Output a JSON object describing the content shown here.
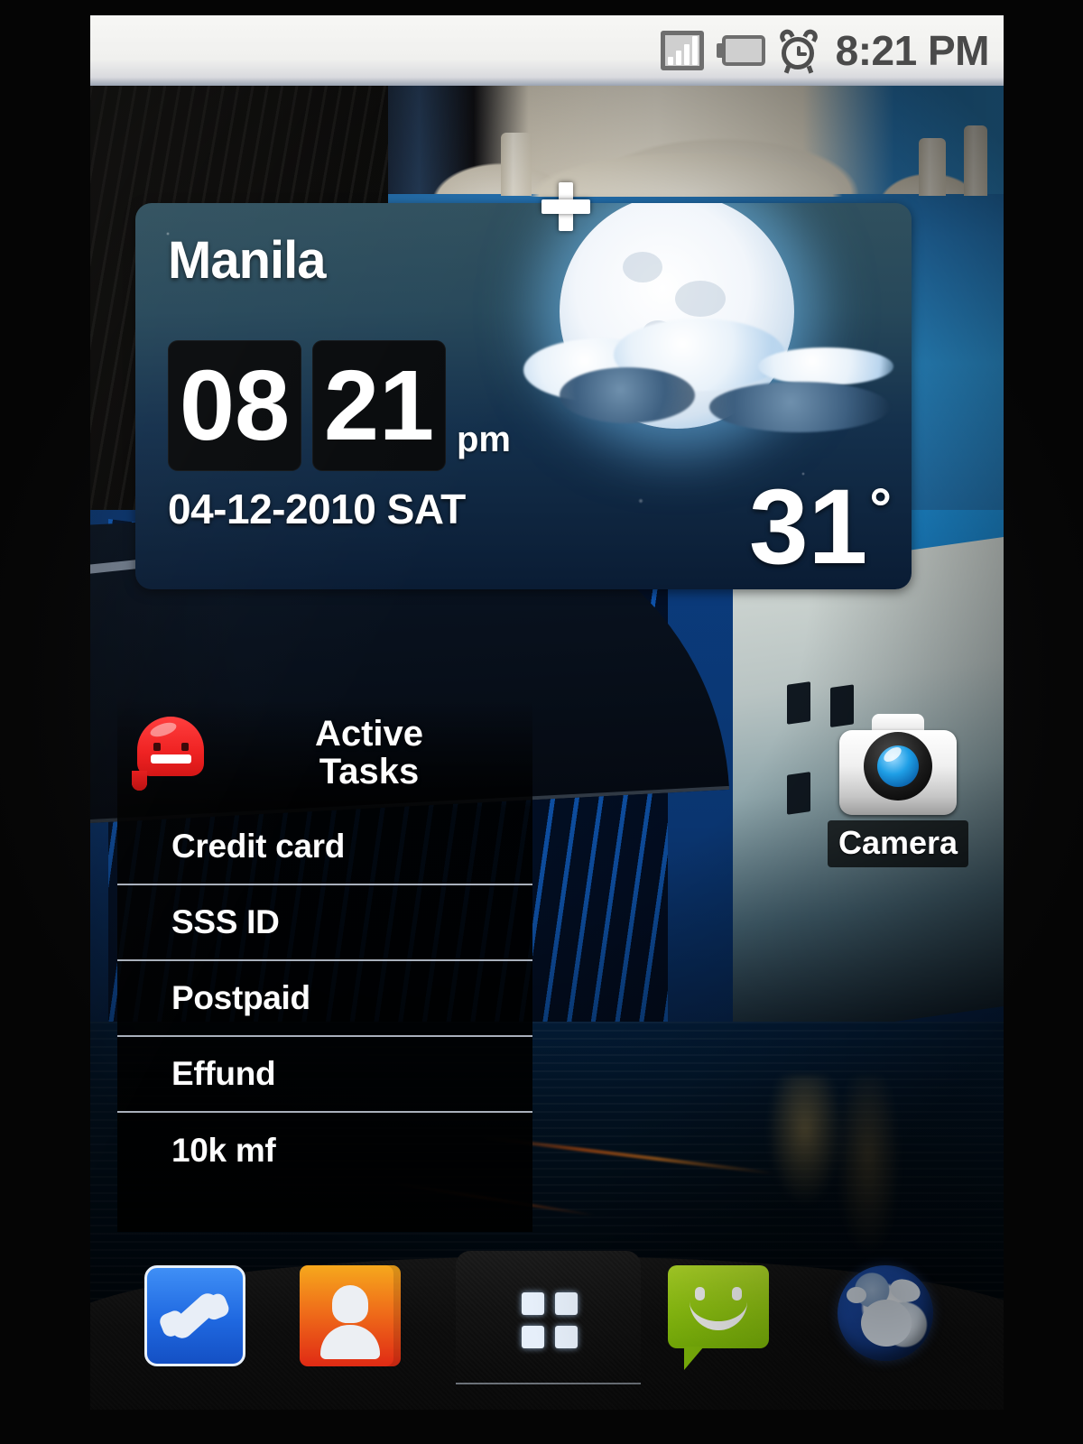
{
  "statusbar": {
    "time": "8:21 PM",
    "icons": [
      "signal-bars-icon",
      "battery-icon",
      "alarm-clock-icon"
    ],
    "battery_color": "#a8cf1c",
    "background_color": "#f2f2f0",
    "text_color": "#4a4a4a"
  },
  "weather_widget": {
    "city": "Manila",
    "hour": "08",
    "minute": "21",
    "ampm": "pm",
    "date": "04-12-2010 SAT",
    "temperature": "31",
    "degree_symbol": "°",
    "condition_icon": "moon-with-clouds-icon",
    "background_color": "#27485a"
  },
  "tasks_widget": {
    "app_icon": "astrid-octopus-icon",
    "title": "Active\nTasks",
    "add_button": "plus-icon",
    "items": [
      {
        "label": "Credit card"
      },
      {
        "label": "SSS ID"
      },
      {
        "label": "Postpaid"
      },
      {
        "label": "Effund"
      },
      {
        "label": "10k mf"
      }
    ]
  },
  "shortcuts": [
    {
      "label": "Camera",
      "icon": "camera-icon"
    }
  ],
  "dock": {
    "items": [
      {
        "name": "phone",
        "icon": "phone-handset-icon",
        "color": "#1f68e0"
      },
      {
        "name": "contacts",
        "icon": "contacts-person-icon",
        "color": "#e02a14"
      },
      {
        "name": "app-drawer",
        "icon": "app-grid-icon",
        "color": "#e6effa"
      },
      {
        "name": "messaging",
        "icon": "message-smiley-icon",
        "color": "#96ce12"
      },
      {
        "name": "browser",
        "icon": "globe-icon",
        "color": "#1a47a0"
      }
    ]
  },
  "wallpaper": {
    "scene": "venice-canal-night-wallpaper"
  }
}
